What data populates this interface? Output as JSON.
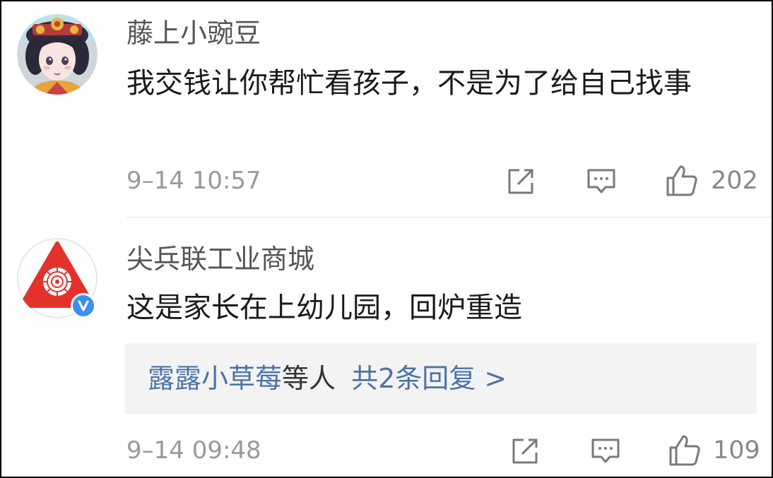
{
  "comments": [
    {
      "username": "藤上小豌豆",
      "text": "我交钱让你帮忙看孩子，不是为了给自己找事",
      "timestamp": "9–14 10:57",
      "likes": "202"
    },
    {
      "username": "尖兵联工业商城",
      "verified": true,
      "text": "这是家长在上幼儿园，回炉重造",
      "replies": {
        "users": "露露小草莓",
        "suffix": "等人",
        "count_label": "共2条回复 >"
      },
      "timestamp": "9–14 09:48",
      "likes": "109"
    }
  ],
  "icons": {
    "share": "share-icon",
    "comment": "comment-icon",
    "like": "thumbs-up-icon",
    "verified": "verified-v-icon"
  },
  "colors": {
    "link": "#4a73a8",
    "meta": "#999999",
    "verified": "#3d8ff0",
    "brand_red": "#e3322b"
  }
}
